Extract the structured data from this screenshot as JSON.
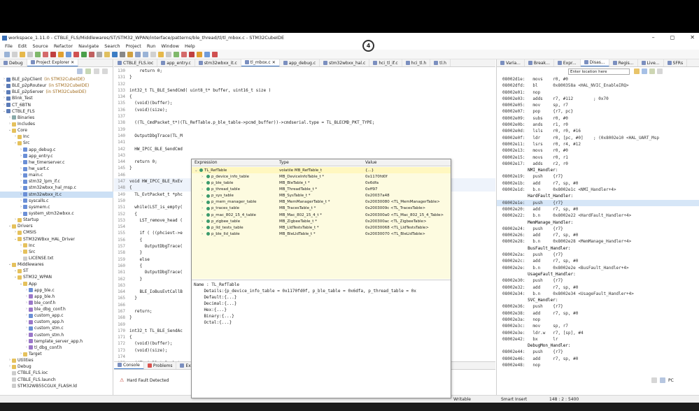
{
  "window": {
    "title": "workspace_1.11.0 - CTBLE_FLS/Middlewares/ST/STM32_WPAN/interface/patterns/ble_thread/tl/tl_mbox.c - STM32CubeIDE"
  },
  "menu": [
    "File",
    "Edit",
    "Source",
    "Refactor",
    "Navigate",
    "Search",
    "Project",
    "Run",
    "Window",
    "Help"
  ],
  "annotation_badge": "4",
  "explorer": {
    "tabs": [
      "Debug",
      "Project Explorer"
    ],
    "tree": [
      {
        "indent": 0,
        "arrow": ">",
        "type": "proj",
        "label": "BLE_p2pClient",
        "dec": "(in STM32CubeIDE)"
      },
      {
        "indent": 0,
        "arrow": ">",
        "type": "proj",
        "label": "BLE_p2pRouteur",
        "dec": "(in STM32CubeIDE)"
      },
      {
        "indent": 0,
        "arrow": ">",
        "type": "proj",
        "label": "BLE_p2pServer",
        "dec": "(in STM32CubeIDE)"
      },
      {
        "indent": 0,
        "arrow": ">",
        "type": "proj",
        "label": "Blink_Test",
        "dec": ""
      },
      {
        "indent": 0,
        "arrow": ">",
        "type": "proj",
        "label": "CT_6BTN",
        "dec": ""
      },
      {
        "indent": 0,
        "arrow": "v",
        "type": "proj",
        "label": "CTBLE_FLS",
        "dec": ""
      },
      {
        "indent": 1,
        "arrow": ">",
        "type": "bin",
        "label": "Binaries",
        "dec": ""
      },
      {
        "indent": 1,
        "arrow": ">",
        "type": "fold",
        "label": "Includes",
        "dec": ""
      },
      {
        "indent": 1,
        "arrow": "v",
        "type": "fold",
        "label": "Core",
        "dec": ""
      },
      {
        "indent": 2,
        "arrow": ">",
        "type": "fold",
        "label": "Inc",
        "dec": ""
      },
      {
        "indent": 2,
        "arrow": "v",
        "type": "fold",
        "label": "Src",
        "dec": ""
      },
      {
        "indent": 3,
        "arrow": ">",
        "type": "c",
        "label": "app_debug.c",
        "dec": ""
      },
      {
        "indent": 3,
        "arrow": ">",
        "type": "c",
        "label": "app_entry.c",
        "dec": ""
      },
      {
        "indent": 3,
        "arrow": ">",
        "type": "c",
        "label": "hw_timerserver.c",
        "dec": ""
      },
      {
        "indent": 3,
        "arrow": ">",
        "type": "c",
        "label": "hw_uart.c",
        "dec": ""
      },
      {
        "indent": 3,
        "arrow": ">",
        "type": "c",
        "label": "main.c",
        "dec": ""
      },
      {
        "indent": 3,
        "arrow": ">",
        "type": "c",
        "label": "stm32_lpm_if.c",
        "dec": ""
      },
      {
        "indent": 3,
        "arrow": ">",
        "type": "c",
        "label": "stm32wbxx_hal_msp.c",
        "dec": ""
      },
      {
        "indent": 3,
        "arrow": ">",
        "type": "c",
        "label": "stm32wbxx_it.c",
        "dec": "",
        "sel": true
      },
      {
        "indent": 3,
        "arrow": ">",
        "type": "c",
        "label": "syscalls.c",
        "dec": ""
      },
      {
        "indent": 3,
        "arrow": ">",
        "type": "c",
        "label": "sysmem.c",
        "dec": ""
      },
      {
        "indent": 3,
        "arrow": ">",
        "type": "c",
        "label": "system_stm32wbxx.c",
        "dec": ""
      },
      {
        "indent": 2,
        "arrow": ">",
        "type": "fold",
        "label": "Startup",
        "dec": ""
      },
      {
        "indent": 1,
        "arrow": "v",
        "type": "fold",
        "label": "Drivers",
        "dec": ""
      },
      {
        "indent": 2,
        "arrow": ">",
        "type": "fold",
        "label": "CMSIS",
        "dec": ""
      },
      {
        "indent": 2,
        "arrow": "v",
        "type": "fold",
        "label": "STM32WBxx_HAL_Driver",
        "dec": ""
      },
      {
        "indent": 3,
        "arrow": ">",
        "type": "fold",
        "label": "Inc",
        "dec": ""
      },
      {
        "indent": 3,
        "arrow": ">",
        "type": "fold",
        "label": "Src",
        "dec": ""
      },
      {
        "indent": 3,
        "arrow": "",
        "type": "file",
        "label": "LICENSE.txt",
        "dec": ""
      },
      {
        "indent": 1,
        "arrow": "v",
        "type": "fold",
        "label": "Middlewares",
        "dec": ""
      },
      {
        "indent": 2,
        "arrow": "v",
        "type": "fold",
        "label": "ST",
        "dec": ""
      },
      {
        "indent": 2,
        "arrow": "v",
        "type": "fold",
        "label": "STM32_WPAN",
        "dec": ""
      },
      {
        "indent": 3,
        "arrow": "v",
        "type": "fold",
        "label": "App",
        "dec": ""
      },
      {
        "indent": 4,
        "arrow": ">",
        "type": "c",
        "label": "app_ble.c",
        "dec": ""
      },
      {
        "indent": 4,
        "arrow": ">",
        "type": "h",
        "label": "app_ble.h",
        "dec": ""
      },
      {
        "indent": 4,
        "arrow": ">",
        "type": "h",
        "label": "ble_conf.h",
        "dec": ""
      },
      {
        "indent": 4,
        "arrow": ">",
        "type": "h",
        "label": "ble_dbg_conf.h",
        "dec": ""
      },
      {
        "indent": 4,
        "arrow": ">",
        "type": "c",
        "label": "custom_app.c",
        "dec": ""
      },
      {
        "indent": 4,
        "arrow": ">",
        "type": "h",
        "label": "custom_app.h",
        "dec": ""
      },
      {
        "indent": 4,
        "arrow": ">",
        "type": "c",
        "label": "custom_stm.c",
        "dec": ""
      },
      {
        "indent": 4,
        "arrow": ">",
        "type": "h",
        "label": "custom_stm.h",
        "dec": ""
      },
      {
        "indent": 4,
        "arrow": ">",
        "type": "h",
        "label": "template_server_app.h",
        "dec": ""
      },
      {
        "indent": 4,
        "arrow": ">",
        "type": "h",
        "label": "tl_dbg_conf.h",
        "dec": ""
      },
      {
        "indent": 3,
        "arrow": ">",
        "type": "fold",
        "label": "Target",
        "dec": ""
      },
      {
        "indent": 1,
        "arrow": ">",
        "type": "fold",
        "label": "Utilities",
        "dec": ""
      },
      {
        "indent": 1,
        "arrow": ">",
        "type": "fold",
        "label": "Debug",
        "dec": ""
      },
      {
        "indent": 1,
        "arrow": "",
        "type": "file",
        "label": "CTBLE_FLS.ioc",
        "dec": ""
      },
      {
        "indent": 1,
        "arrow": "",
        "type": "file",
        "label": "CTBLE_FLS.launch",
        "dec": ""
      },
      {
        "indent": 1,
        "arrow": "",
        "type": "file",
        "label": "STM32WB55CGUX_FLASH.ld",
        "dec": ""
      }
    ]
  },
  "editor": {
    "tabs": [
      "CTBLE_FLS.ioc",
      "app_entry.c",
      "stm32wbxx_it.c",
      "tl_mbox.c",
      "app_debug.c",
      "stm32wbxx_hal.c",
      "hci_tl_if.c",
      "hci_tl.h",
      "tl.h"
    ],
    "active_tab": 3,
    "lines": [
      {
        "n": "130",
        "t": "    return 0;"
      },
      {
        "n": "131",
        "t": "}"
      },
      {
        "n": "132",
        "t": ""
      },
      {
        "n": "133",
        "t": "int32_t TL_BLE_SendCmd( uint8_t* buffer, uint16_t size )"
      },
      {
        "n": "134",
        "t": "{"
      },
      {
        "n": "135",
        "t": "  (void)(buffer);"
      },
      {
        "n": "136",
        "t": "  (void)(size);"
      },
      {
        "n": "137",
        "t": ""
      },
      {
        "n": "138",
        "t": "  ((TL_CmdPacket_t*)(TL_RefTable.p_ble_table->pcmd_buffer))->cmdserial.type = TL_BLECMD_PKT_TYPE;"
      },
      {
        "n": "139",
        "t": ""
      },
      {
        "n": "140",
        "t": "  OutputDbgTrace(TL_M"
      },
      {
        "n": "141",
        "t": ""
      },
      {
        "n": "142",
        "t": "  HW_IPCC_BLE_SendCmd"
      },
      {
        "n": "143",
        "t": ""
      },
      {
        "n": "144",
        "t": "  return 0;"
      },
      {
        "n": "145",
        "t": "}"
      },
      {
        "n": "146",
        "t": ""
      },
      {
        "n": "147",
        "t": "void HW_IPCC_BLE_RxEv"
      },
      {
        "n": "148",
        "t": "{"
      },
      {
        "n": "149",
        "t": "  TL_EvtPacket_t *phc"
      },
      {
        "n": "150",
        "t": ""
      },
      {
        "n": "151",
        "t": "  while(LST_is_empty("
      },
      {
        "n": "152",
        "t": "  {"
      },
      {
        "n": "153",
        "t": "    LST_remove_head ("
      },
      {
        "n": "154",
        "t": ""
      },
      {
        "n": "155",
        "t": "    if ( ((phcievt->e                                                                 LEEVT_CC_OPC"
      },
      {
        "n": "156",
        "t": "    {"
      },
      {
        "n": "157",
        "t": "      OutputDbgTrace("
      },
      {
        "n": "158",
        "t": "    }"
      },
      {
        "n": "159",
        "t": "    else"
      },
      {
        "n": "160",
        "t": "    {"
      },
      {
        "n": "161",
        "t": "      OutputDbgTrace("
      },
      {
        "n": "162",
        "t": "    }"
      },
      {
        "n": "163",
        "t": ""
      },
      {
        "n": "164",
        "t": "    BLE_IoBusEvtCallB"
      },
      {
        "n": "165",
        "t": "  }"
      },
      {
        "n": "166",
        "t": ""
      },
      {
        "n": "167",
        "t": "  return;"
      },
      {
        "n": "168",
        "t": "}"
      },
      {
        "n": "169",
        "t": ""
      },
      {
        "n": "170",
        "t": "int32_t TL_BLE_SendAc"
      },
      {
        "n": "171",
        "t": "{"
      },
      {
        "n": "172",
        "t": "  (void)(buffer);"
      },
      {
        "n": "173",
        "t": "  (void)(size);"
      },
      {
        "n": "174",
        "t": ""
      },
      {
        "n": "175",
        "t": "  ((TL_AclDataPacket_                                                              TYPE;"
      }
    ]
  },
  "hover": {
    "headers": [
      "Expression",
      "Type",
      "Value"
    ],
    "rows": [
      {
        "expr": "TL_RefTable",
        "type": "volatile MB_RefTable_t",
        "value": "{...}",
        "root": true
      },
      {
        "expr": "p_device_info_table",
        "type": "MB_DeviceInfoTable_t *",
        "value": "0x1170fd0f"
      },
      {
        "expr": "p_ble_table",
        "type": "MB_BleTable_t *",
        "value": "0x6dfa"
      },
      {
        "expr": "p_thread_table",
        "type": "MB_ThreadTable_t *",
        "value": "0xff97"
      },
      {
        "expr": "p_sys_table",
        "type": "MB_SysTable_t *",
        "value": "0x20037a48"
      },
      {
        "expr": "p_mem_manager_table",
        "type": "MB_MemManagerTable_t *",
        "value": "0x20030080 <TL_MemManagerTable>"
      },
      {
        "expr": "p_traces_table",
        "type": "MB_TracesTable_t *",
        "value": "0x2003009c <TL_TracesTable>"
      },
      {
        "expr": "p_mac_802_15_4_table",
        "type": "MB_Mac_802_15_4_t *",
        "value": "0x200300a0 <TL_Mac_802_15_4_Table>"
      },
      {
        "expr": "p_zigbee_table",
        "type": "MB_ZigbeeTable_t *",
        "value": "0x200300ac <TL_ZigbeeTable>"
      },
      {
        "expr": "p_lld_tests_table",
        "type": "MB_LldTestsTable_t *",
        "value": "0x20030068 <TL_LldTestsTable>"
      },
      {
        "expr": "p_ble_lld_table",
        "type": "MB_BleLldTable_t *",
        "value": "0x20030070 <TL_BleLldTable>"
      }
    ],
    "detail": "Name : TL_RefTable\n    Details:{p_device_info_table = 0x1170fd0f, p_ble_table = 0x6dfa, p_thread_table = 0x\n    Default:{...}\n    Decimal:{...}\n    Hex:{...}\n    Binary:{...}\n    Octal:{...}"
  },
  "console": {
    "tabs": [
      "Console",
      "Problems",
      "Executa"
    ],
    "message": "Hard Fault Detected",
    "pc_label": "PC"
  },
  "disasm": {
    "tabs": [
      "Varia...",
      "Break...",
      "Expr...",
      "Disas...",
      "Regis...",
      "Live...",
      "SFRs"
    ],
    "location_placeholder": "Enter location here",
    "lines": [
      {
        "t": "08002d1e:   movs    r0, #0"
      },
      {
        "t": "08002dfd:   bl      0x800358a <HAL_NVIC_EnableIRQ>"
      },
      {
        "t": "08002e01:   nop"
      },
      {
        "t": "08002e03:   adds    r7, #112        ; 0x70"
      },
      {
        "t": "08002e05:   mov     sp, r7"
      },
      {
        "t": "08002e07:   pop     {r7, pc}"
      },
      {
        "t": "08002e09:   subs    r0, #0"
      },
      {
        "t": "08002e0b:   ands    r1, r0"
      },
      {
        "t": "08002e0d:   lsls    r0, r0, #16"
      },
      {
        "t": "08002e0f:   ldr     r0, [pc, #0]    ; (0x8002e10 <HAL_UART_Msp"
      },
      {
        "t": "08002e11:   lsrs    r0, r4, #12"
      },
      {
        "t": "08002e13:   movs    r0, #0"
      },
      {
        "t": "08002e15:   movs    r0, r1"
      },
      {
        "t": "08002e17:   adds    r2, r0"
      },
      {
        "t": "          NMI_Handler:",
        "lbl": true
      },
      {
        "t": "08002e19:   push    {r7}"
      },
      {
        "t": "08002e1b:   add     r7, sp, #0"
      },
      {
        "t": "08002e1d:   b.n     0x8002e1c <NMI_Handler+4>"
      },
      {
        "t": "          HardFault_Handler:",
        "lbl": true
      },
      {
        "t": "08002e1e:   push    {r7}",
        "cur": true
      },
      {
        "t": "08002e20:   add     r7, sp, #0"
      },
      {
        "t": "08002e22:   b.n     0x8002e22 <HardFault_Handler+4>"
      },
      {
        "t": "          MemManage_Handler:",
        "lbl": true
      },
      {
        "t": "08002e24:   push    {r7}"
      },
      {
        "t": "08002e26:   add     r7, sp, #0"
      },
      {
        "t": "08002e28:   b.n     0x8002e28 <MemManage_Handler+4>"
      },
      {
        "t": "          BusFault_Handler:",
        "lbl": true
      },
      {
        "t": "08002e2a:   push    {r7}"
      },
      {
        "t": "08002e2c:   add     r7, sp, #0"
      },
      {
        "t": "08002e2e:   b.n     0x8002e2e <BusFault_Handler+4>"
      },
      {
        "t": "          UsageFault_Handler:",
        "lbl": true
      },
      {
        "t": "08002e30:   push    {r7}"
      },
      {
        "t": "08002e32:   add     r7, sp, #0"
      },
      {
        "t": "08002e34:   b.n     0x8002e34 <UsageFault_Handler+4>"
      },
      {
        "t": "          SVC_Handler:",
        "lbl": true
      },
      {
        "t": "08002e36:   push    {r7}"
      },
      {
        "t": "08002e38:   add     r7, sp, #0"
      },
      {
        "t": "08002e3a:   nop"
      },
      {
        "t": "08002e3c:   mov     sp, r7"
      },
      {
        "t": "08002e3e:   ldr.w   r7, [sp], #4"
      },
      {
        "t": "08002e42:   bx      lr"
      },
      {
        "t": "          DebugMon_Handler:",
        "lbl": true
      },
      {
        "t": "08002e44:   push    {r7}"
      },
      {
        "t": "08002e46:   add     r7, sp, #0"
      },
      {
        "t": "08002e48:   nop"
      }
    ]
  },
  "status": {
    "mode": "Writable",
    "insert": "Smart Insert",
    "position": "148 : 2 : 5400"
  }
}
